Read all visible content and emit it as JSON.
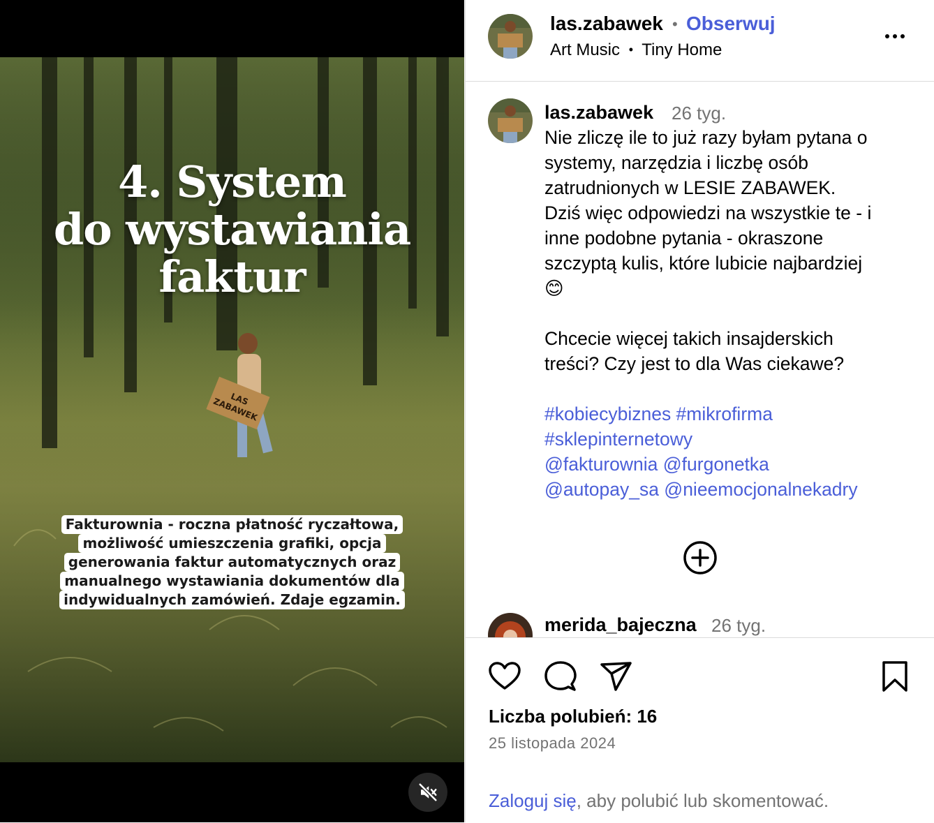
{
  "media": {
    "headline": [
      "4. System",
      "do wystawiania",
      "faktur"
    ],
    "caption": [
      "Fakturownia - roczna płatność ryczałtowa,",
      "możliwość umieszczenia grafiki, opcja",
      "generowania faktur automatycznych oraz",
      "manualnego wystawiania dokumentów dla",
      "indywidualnych zamówień. Zdaje egzamin."
    ],
    "sign_text": "LAS ZABAWEK"
  },
  "header": {
    "username": "las.zabawek",
    "separator": "•",
    "follow_label": "Obserwuj",
    "audio": "Art Music",
    "audio_sep": "•",
    "audio_track": "Tiny Home"
  },
  "caption_comment": {
    "username": "las.zabawek",
    "time": "26 tyg.",
    "lines": [
      "Nie zliczę ile to już razy byłam pytana o",
      "systemy, narzędzia i liczbę osób",
      "zatrudnionych w LESIE ZABAWEK.",
      "Dziś więc odpowiedzi na wszystkie te - i",
      "inne podobne pytania - okraszone",
      "szczyptą kulis, które lubicie najbardziej",
      "😊"
    ],
    "lines2": [
      "Chcecie więcej takich insajderskich",
      "treści? Czy jest to dla Was ciekawe?"
    ],
    "tag_lines": [
      "#kobiecybiznes #mikrofirma",
      "#sklepinternetowy",
      "@fakturownia @furgonetka",
      "@autopay_sa @nieemocjonalnekadry"
    ]
  },
  "second_comment": {
    "username": "merida_bajeczna",
    "time": "26 tyg."
  },
  "actions": {
    "likes": "Liczba polubień: 16",
    "date": "25 listopada 2024",
    "login_link": "Zaloguj się",
    "login_rest": ", aby polubić lub skomentować."
  },
  "icons": [
    "mute-icon",
    "more-icon",
    "plus-circle-icon",
    "heart-icon",
    "comment-icon",
    "share-icon",
    "bookmark-icon"
  ]
}
